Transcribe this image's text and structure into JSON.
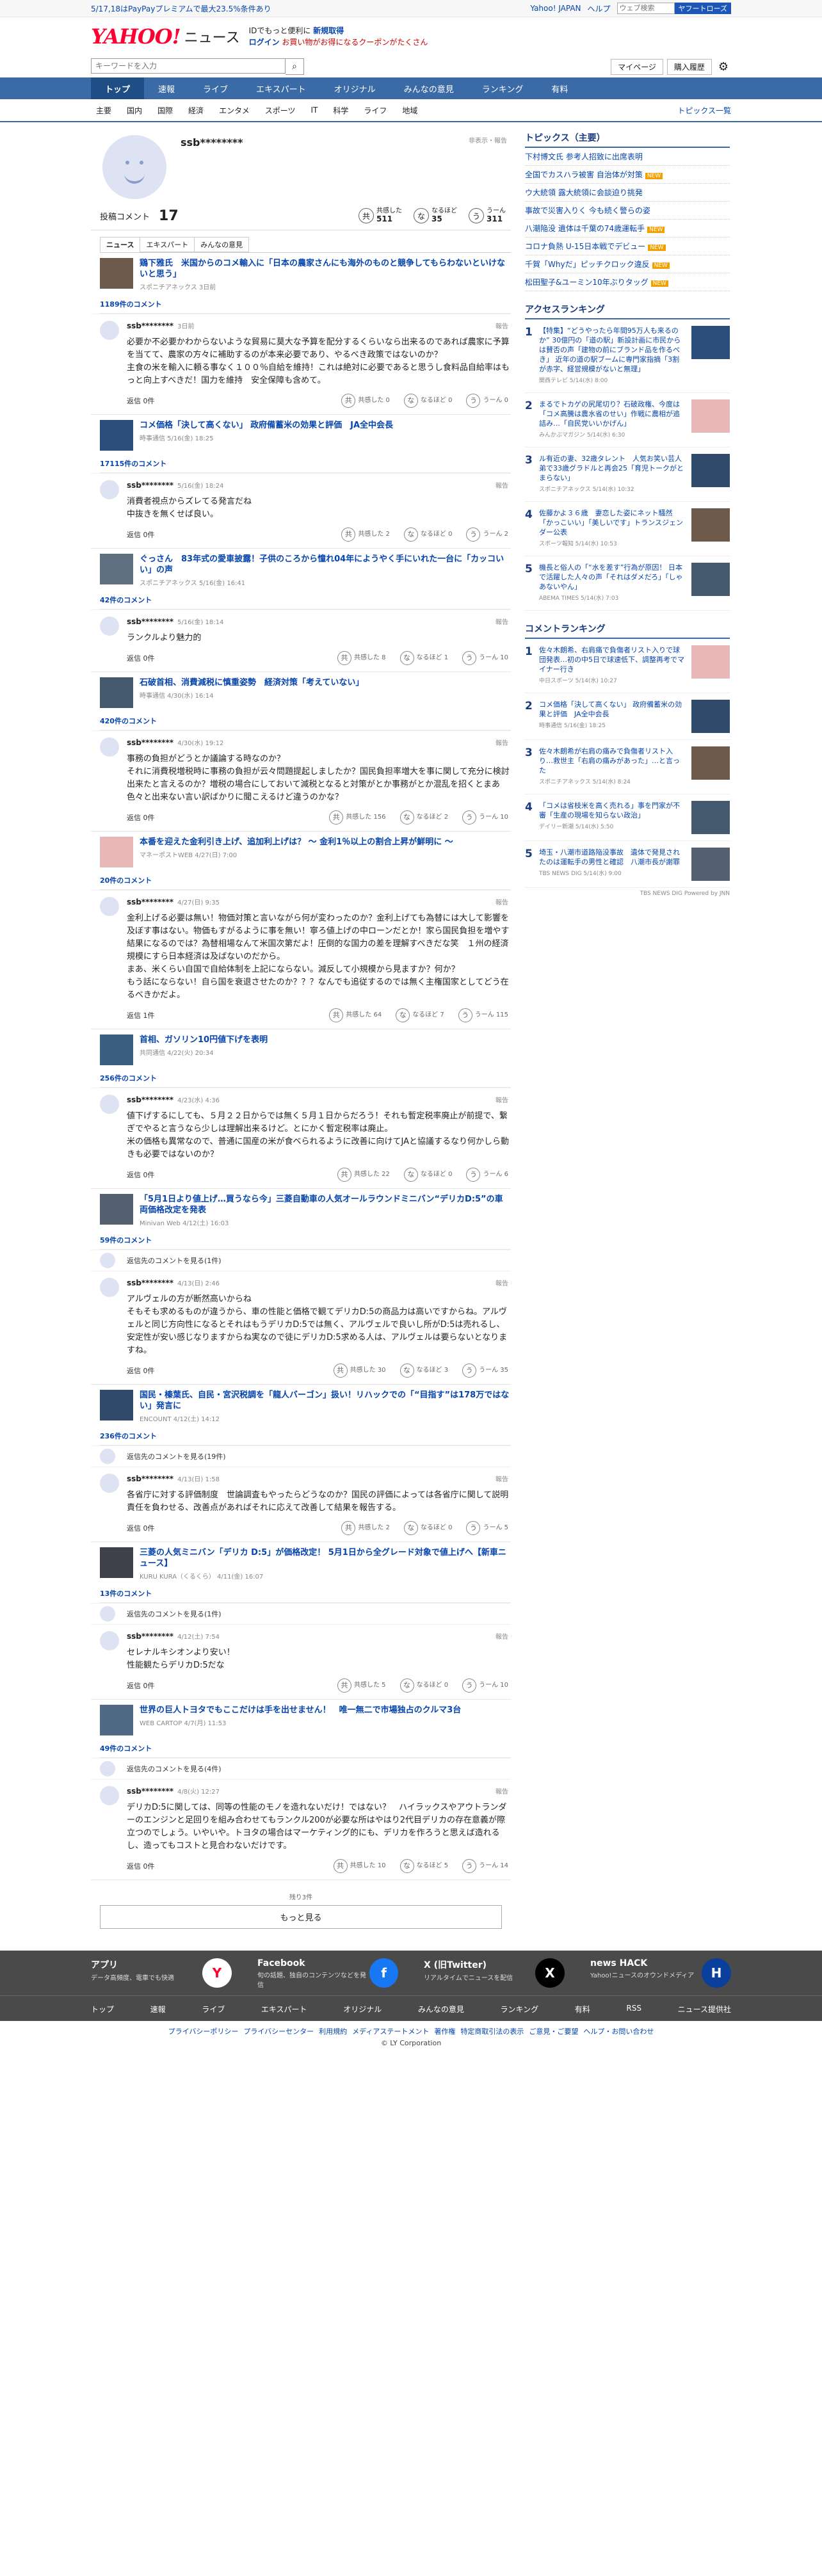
{
  "promo": {
    "text": "5/17,18はPayPayプレミアムで最大23.5%条件あり"
  },
  "header": {
    "links": [
      "Yahoo! JAPAN",
      "ヘルプ"
    ],
    "search_placeholder": "ウェブ検索",
    "search_button": "ヤフートローズ",
    "logo": "YAHOO!",
    "logo_sub": "JAPAN",
    "service": "ニュース",
    "tagline": "IDでもっと便利に",
    "signup": "新規取得",
    "login": "ログイン",
    "coupon": "お買い物がお得になるクーポンがたくさん"
  },
  "searchrow": {
    "placeholder": "キーワードを入力",
    "mypage": "マイページ",
    "history": "購入履歴"
  },
  "nav": [
    "トップ",
    "速報",
    "ライブ",
    "エキスパート",
    "オリジナル",
    "みんなの意見",
    "ランキング",
    "有料"
  ],
  "subnav": [
    "主要",
    "国内",
    "国際",
    "経済",
    "エンタメ",
    "スポーツ",
    "IT",
    "科学",
    "ライフ",
    "地域"
  ],
  "subnav_right": "トピックス一覧",
  "profile": {
    "name": "ssb********",
    "report": "非表示・報告",
    "label": "投稿コメント",
    "count": "17",
    "stats": [
      {
        "icon": "共",
        "label": "共感した",
        "value": "511"
      },
      {
        "icon": "な",
        "label": "なるほど",
        "value": "35"
      },
      {
        "icon": "う",
        "label": "うーん",
        "value": "311"
      }
    ],
    "tabs": [
      "ニュース",
      "エキスパート",
      "みんなの意見"
    ]
  },
  "groups": [
    {
      "title": "鶏下雅氏　米国からのコメ輸入に「日本の農家さんにも海外のものと競争してもらわないといけないと思う」",
      "src": "スポニチアネックス 3日前",
      "count": "1189件のコメント",
      "comments": [
        {
          "user": "ssb********",
          "date": "3日前",
          "text": "必要か不必要かわからないような貿易に莫大な予算を配分するくらいなら出来るのであれば農家に予算を当てて、農家の方々に補助するのが本来必要であり、やるべき政策ではないのか？\n主食の米を輸入に頼る事なく１００％自給を維持！これは絶対に必要であると思うし食料品自給率はもっと向上すべきだ！国力を維持　安全保障も含めて。",
          "reply": "返信 0件",
          "votes": [
            "共感した 0",
            "なるほど 0",
            "うーん 0"
          ]
        }
      ]
    },
    {
      "title": "コメ価格「決して高くない」 政府備蓄米の効果と評価　JA全中会長",
      "src": "時事通信 5/16(金) 18:25",
      "count": "17115件のコメント",
      "comments": [
        {
          "user": "ssb********",
          "date": "5/16(金) 18:24",
          "text": "消費者視点からズレてる発言だね\n中抜きを無くせば良い。",
          "reply": "返信 0件",
          "votes": [
            "共感した 2",
            "なるほど 0",
            "うーん 2"
          ]
        }
      ]
    },
    {
      "title": "ぐっさん　83年式の愛車披露！子供のころから憧れ04年にようやく手にいれた一台に「カッコいい」の声",
      "src": "スポニチアネックス 5/16(金) 16:41",
      "count": "42件のコメント",
      "comments": [
        {
          "user": "ssb********",
          "date": "5/16(金) 18:14",
          "text": "ランクルより魅力的",
          "reply": "返信 0件",
          "votes": [
            "共感した 8",
            "なるほど 1",
            "うーん 10"
          ]
        }
      ]
    },
    {
      "title": "石破首相、消費減税に慎重姿勢　経済対策「考えていない」",
      "src": "時事通信 4/30(水) 16:14",
      "count": "420件のコメント",
      "comments": [
        {
          "user": "ssb********",
          "date": "4/30(水) 19:12",
          "text": "事務の負担がどうとか議論する時なのか？\nそれに消費税増税時に事務の負担が云々問題提起しましたか？国民負担率増大を事に関して充分に検討出来たと言えるのか？増税の場合にしておいて減税となると対策がとか事務がとか混乱を招くとまあ色々と出来ない言い訳ばかりに聞こえるけど違うのかな？",
          "reply": "返信 0件",
          "votes": [
            "共感した 156",
            "なるほど 2",
            "うーん 10"
          ]
        }
      ]
    },
    {
      "title": "本番を迎えた金利引き上げ、追加利上げは？ ～ 金利1％以上の割合上昇が鮮明に ～",
      "src": "マネーポストWEB 4/27(日) 7:00",
      "count": "20件のコメント",
      "comments": [
        {
          "user": "ssb********",
          "date": "4/27(日) 9:35",
          "text": "金利上げる必要は無い！物価対策と言いながら何が変わったのか？金利上げても為替には大して影響を及ぼす事はない。物価もすがるように事を無い！寧ろ値上げの中ローンだとか！家ら国民負担を増やす結果になるのでは？為替相場なんて米国次第だよ！圧倒的な国力の差を理解すべきだな笑　１州の経済規模にすら日本経済は及ばないのだから。\nまあ、米くらい自国で自給体制を上記にならない。減反して小規模から見ますか？何か？\nもう話にならない！自ら国を衰退させたのか？？？なんでも追従するのでは無く主権国家としてどう在るべきかだよ。",
          "reply": "返信 1件",
          "votes": [
            "共感した 64",
            "なるほど 7",
            "うーん 115"
          ]
        }
      ]
    },
    {
      "title": "首相、ガソリン10円値下げを表明",
      "src": "共同通信 4/22(火) 20:34",
      "count": "256件のコメント",
      "comments": [
        {
          "user": "ssb********",
          "date": "4/23(水) 4:36",
          "text": "値下げするにしても、５月２２日からでは無く５月１日からだろう！それも暫定税率廃止が前提で、繋ぎでやると言うなら少しは理解出来るけど。とにかく暫定税率は廃止。\n米の価格も異常なので、普通に国産の米が食べられるように改善に向けてJAと協議するなり何かしら動きも必要ではないのか？",
          "reply": "返信 0件",
          "votes": [
            "共感した 22",
            "なるほど 0",
            "うーん 6"
          ]
        }
      ]
    },
    {
      "title": "「5月1日より値上げ…買うなら今」三菱自動車の人気オールラウンドミニバン“デリカD:5”の車両価格改定を発表",
      "src": "Minivan Web 4/12(土) 16:03",
      "count": "59件のコメント",
      "comments": [
        {
          "pre": "返信先のコメントを見る(1件)",
          "user": "ssb********",
          "date": "4/13(日) 2:46",
          "text": "アルヴェルの方が断然高いからね\nそもそも求めるものが違うから、車の性能と価格で観てデリカD:5の商品力は高いですからね。アルヴェルと同じ方向性になるとそれはもうデリカD:5では無く、アルヴェルで良いし所がD:5は売れるし、安定性が安い感じなりますからね実なので徒にデリカD:5求める人は、アルヴェルは要らないとなりますね。",
          "reply": "返信 0件",
          "votes": [
            "共感した 30",
            "なるほど 3",
            "うーん 35"
          ]
        }
      ]
    },
    {
      "title": "国民・榛葉氏、自民・宮沢税調を「龍人バーゴン」扱い！リハックでの「“目指す”は178万ではない」発言に",
      "src": "ENCOUNT 4/12(土) 14:12",
      "count": "236件のコメント",
      "comments": [
        {
          "pre": "返信先のコメントを見る(19件)",
          "user": "ssb********",
          "date": "4/13(日) 1:58",
          "text": "各省庁に対する評価制度　世論調査もやったらどうなのか？国民の評価によっては各省庁に関して説明責任を負わせる、改善点があればそれに応えて改善して結果を報告する。",
          "reply": "返信 0件",
          "votes": [
            "共感した 2",
            "なるほど 0",
            "うーん 5"
          ]
        }
      ]
    },
    {
      "title": "三菱の人気ミニバン「デリカ D:5」が価格改定！ 5月1日から全グレード対象で値上げへ【新車ニュース】",
      "src": "KURU KURA（くるくら） 4/11(金) 16:07",
      "count": "13件のコメント",
      "comments": [
        {
          "pre": "返信先のコメントを見る(1件)",
          "user": "ssb********",
          "date": "4/12(土) 7:54",
          "text": "セレナルキシオンより安い！\n性能観たらデリカD:5だな",
          "reply": "返信 0件",
          "votes": [
            "共感した 5",
            "なるほど 0",
            "うーん 10"
          ]
        }
      ]
    },
    {
      "title": "世界の巨人トヨタでもここだけは手を出せません！　唯一無二で市場独占のクルマ3台",
      "src": "WEB CARTOP 4/7(月) 11:53",
      "count": "49件のコメント",
      "comments": [
        {
          "pre": "返信先のコメントを見る(4件)",
          "user": "ssb********",
          "date": "4/8(火) 12:27",
          "text": "デリカD:5に関しては、同等の性能のモノを造れないだけ！ではない？　ハイラックスやアウトランダーのエンジンと足回りを組み合わせてもランクル200が必要な所はやはり2代目デリカの存在意義が際立つのでしょう。いやいや。トヨタの場合はマーケティング的にも、デリカを作ろうと思えば造れるし、造ってもコストと見合わないだけです。",
          "reply": "返信 0件",
          "votes": [
            "共感した 10",
            "なるほど 5",
            "うーん 14"
          ]
        }
      ]
    }
  ],
  "more": {
    "count": "残り3件",
    "button": "もっと見る"
  },
  "side": {
    "topics_title": "トピックス（主要）",
    "topics": [
      {
        "text": "下村博文氏 参考人招致に出席表明",
        "badge": ""
      },
      {
        "text": "全国でカスハラ被害 自治体が対策",
        "badge": "NEW"
      },
      {
        "text": "ウ大統領 露大統領に会談迫り挑発",
        "badge": ""
      },
      {
        "text": "事故で災害入りく 今も続く警らの姿",
        "badge": ""
      },
      {
        "text": "八潮陥没 遺体は千葉の74歳運転手",
        "badge": "NEW"
      },
      {
        "text": "コロナ負熱 U-15日本戦でデビュー",
        "badge": "NEW"
      },
      {
        "text": "千賀「Whyだ」ピッチクロック違反",
        "badge": "NEW"
      },
      {
        "text": "松田聖子&ユーミン10年ぶりタッグ",
        "badge": "NEW"
      }
    ],
    "access_title": "アクセスランキング",
    "access": [
      {
        "text": "【特集】“どうやったら年間95万人も来るのか” 30億円の「道の駅」新設計画に市民からは賛否の声「建物の前にブランド品を作るべき」 近年の道の駅ブームに専門家指摘「3割が赤字、経営規模がないと無理」",
        "src": "関西テレビ 5/14(水) 8:00"
      },
      {
        "text": "まるでトカゲの尻尾切り？石破政権、今度は「コメ高騰は農水省のせい」作戦に農相が追詰み…「自民党いいかげん」",
        "src": "みんかぶマガジン 5/14(水) 6:30"
      },
      {
        "text": "ル有近の妻、32歳タレント　人気お笑い芸人弟で33歳グラドルと再会25「育児トークがとまらない」",
        "src": "スポニチアネックス 5/14(水) 10:32"
      },
      {
        "text": "佐藤かよ３６歳　妻恋した姿にネット騒然「かっこいい」「美しいです」トランスジェンダー公表",
        "src": "スポーツ報知 5/14(水) 10:53"
      },
      {
        "text": "機長と俗人の「“水を差す”行為が原因！ 日本で活躍した人々の声「それはダメだろ」「しゃあないやん」",
        "src": "ABEMA TIMES 5/14(水) 7:03"
      }
    ],
    "comment_title": "コメントランキング",
    "comments": [
      {
        "text": "佐々木朗希、右肩痛で負傷者リスト入りで球団発表…初の中5日で球速低下、調整再考でマイナー行き",
        "src": "中日スポーツ 5/14(水) 10:27"
      },
      {
        "text": "コメ価格「決して高くない」 政府備蓄米の効果と評価　JA全中会長",
        "src": "時事通信 5/16(金) 18:25"
      },
      {
        "text": "佐々木朗希が右肩の痛みで負傷者リスト入り…救世主「右肩の痛みがあった」…と言った",
        "src": "スポニチアネックス 5/14(水) 8:24"
      },
      {
        "text": "「コメは省枝米を高く売れる」事を門家が不審「生産の現場を知らない政治」",
        "src": "デイリー新潮 5/14(水) 5:50"
      },
      {
        "text": "埼玉・八潮市道路陥没事故　遺体で発見されたのは運転手の男性と確認　八潮市長が謝罪",
        "src": "TBS NEWS DIG 5/14(水) 9:00"
      }
    ],
    "powered": "TBS NEWS DIG Powered by JNN"
  },
  "footer": {
    "cols": [
      {
        "title": "アプリ",
        "desc": "データ高頻度、電車でも快適",
        "icon": "Y"
      },
      {
        "title": "Facebook",
        "desc": "旬の話題、独自のコンテンツなどを発信",
        "icon": "f"
      },
      {
        "title": "X (旧Twitter)",
        "desc": "リアルタイムでニュースを配信",
        "icon": "X"
      },
      {
        "title": "news HACK",
        "desc": "Yahoo!ニュースのオウンドメディア",
        "icon": "H"
      }
    ],
    "links": [
      "トップ",
      "速報",
      "ライブ",
      "エキスパート",
      "オリジナル",
      "みんなの意見",
      "ランキング",
      "有料",
      "RSS",
      "ニュース提供社"
    ],
    "legal": [
      "プライバシーポリシー",
      "プライバシーセンター",
      "利用規約",
      "メディアステートメント",
      "著作権",
      "特定商取引法の表示",
      "ご意見・ご要望",
      "ヘルプ・お問い合わせ"
    ],
    "copyright": "© LY Corporation"
  }
}
